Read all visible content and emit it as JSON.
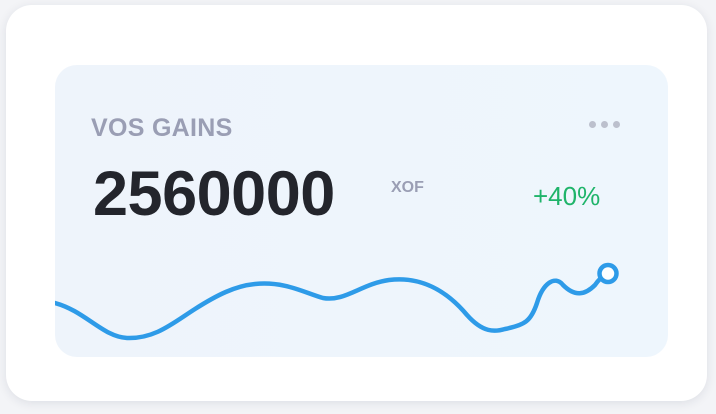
{
  "card": {
    "title": "VOS GAINS",
    "amount": "2560000",
    "currency": "XOF",
    "change": "+40%",
    "menu_icon": "more-horizontal-icon"
  },
  "colors": {
    "line": "#2e9be8",
    "positive": "#1fb46a",
    "label": "#9a9eb4",
    "amount": "#23252c"
  }
}
